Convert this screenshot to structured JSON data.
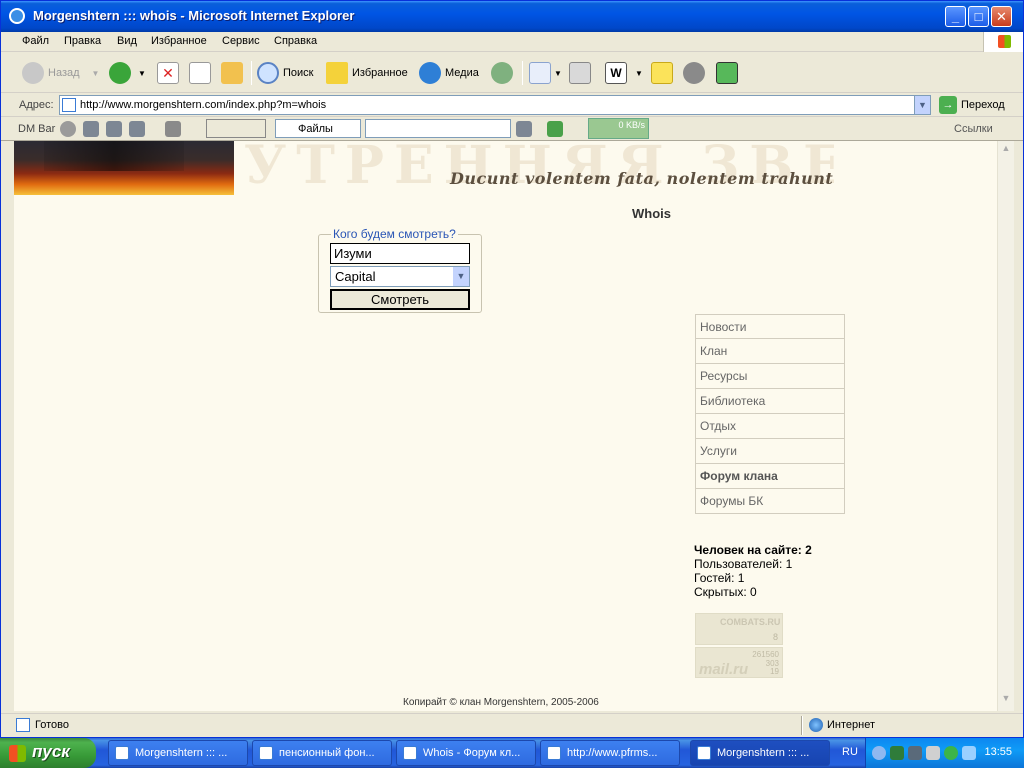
{
  "window": {
    "title": "Morgenshtern ::: whois - Microsoft Internet Explorer",
    "buttons": [
      "_",
      "□",
      "✕"
    ]
  },
  "menu": [
    "Файл",
    "Правка",
    "Вид",
    "Избранное",
    "Сервис",
    "Справка"
  ],
  "toolbar": {
    "back_label": "Назад",
    "search_label": "Поиск",
    "favorites_label": "Избранное",
    "media_label": "Медиа"
  },
  "address": {
    "label": "Адрес:",
    "url": "http://www.morgenshtern.com/index.php?m=whois",
    "go_label": "Переход"
  },
  "dmbar": {
    "label": "DM Bar",
    "files_label": "Файлы",
    "speed": "0 KB/s",
    "links_label": "Ссылки"
  },
  "page": {
    "watermark": "УТРЕННЯЯ ЗВЕЗДА",
    "motto": "Ducunt volentem fata, nolentem trahunt",
    "title": "Whois",
    "form": {
      "legend": "Кого будем смотреть?",
      "name_value": "Изуми",
      "server_value": "Capital",
      "submit_label": "Смотреть"
    },
    "nav": [
      {
        "label": "Новости",
        "bold": false
      },
      {
        "label": "Клан",
        "bold": false
      },
      {
        "label": "Ресурсы",
        "bold": false
      },
      {
        "label": "Библиотека",
        "bold": false
      },
      {
        "label": "Отдых",
        "bold": false
      },
      {
        "label": "Услуги",
        "bold": false
      },
      {
        "label": "Форум клана",
        "bold": true
      },
      {
        "label": "Форумы БК",
        "bold": false
      }
    ],
    "online": {
      "header": "Человек на сайте: 2",
      "users": "Пользователей: 1",
      "guests": "Гостей: 1",
      "hidden": "Скрытых: 0"
    },
    "counter1": {
      "title": "COMBATS.RU",
      "value": "8"
    },
    "counter2": {
      "line1": "261560",
      "line2": "303",
      "line3": "19",
      "brand": "mail.ru"
    },
    "copyright": "Копирайт © клан Morgenshtern, 2005-2006"
  },
  "status": {
    "text": "Готово",
    "zone": "Интернет"
  },
  "taskbar": {
    "start_label": "пуск",
    "tasks": [
      {
        "label": "Morgenshtern ::: ...",
        "active": false
      },
      {
        "label": "пенсионный фон...",
        "active": false
      },
      {
        "label": "Whois - Форум кл...",
        "active": false
      },
      {
        "label": "http://www.pfrms...",
        "active": false
      },
      {
        "label": "Morgenshtern ::: ...",
        "active": true
      }
    ],
    "language": "RU",
    "clock": "13:55"
  },
  "colors": {
    "titlebar": "#0055e5",
    "page_background": "#fdfaee",
    "legend_text": "#2a55b5",
    "taskbar": "#2157d7",
    "start_button": "#379a37"
  }
}
